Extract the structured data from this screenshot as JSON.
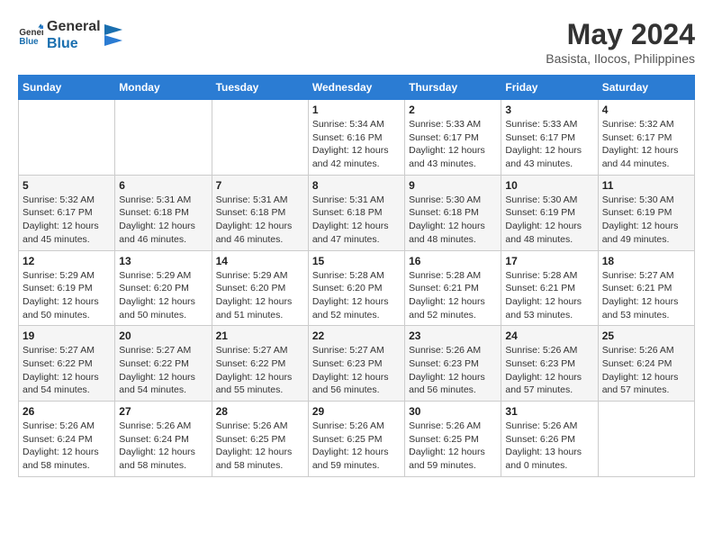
{
  "header": {
    "logo_line1": "General",
    "logo_line2": "Blue",
    "month_year": "May 2024",
    "location": "Basista, Ilocos, Philippines"
  },
  "weekdays": [
    "Sunday",
    "Monday",
    "Tuesday",
    "Wednesday",
    "Thursday",
    "Friday",
    "Saturday"
  ],
  "weeks": [
    [
      {
        "day": "",
        "info": ""
      },
      {
        "day": "",
        "info": ""
      },
      {
        "day": "",
        "info": ""
      },
      {
        "day": "1",
        "info": "Sunrise: 5:34 AM\nSunset: 6:16 PM\nDaylight: 12 hours\nand 42 minutes."
      },
      {
        "day": "2",
        "info": "Sunrise: 5:33 AM\nSunset: 6:17 PM\nDaylight: 12 hours\nand 43 minutes."
      },
      {
        "day": "3",
        "info": "Sunrise: 5:33 AM\nSunset: 6:17 PM\nDaylight: 12 hours\nand 43 minutes."
      },
      {
        "day": "4",
        "info": "Sunrise: 5:32 AM\nSunset: 6:17 PM\nDaylight: 12 hours\nand 44 minutes."
      }
    ],
    [
      {
        "day": "5",
        "info": "Sunrise: 5:32 AM\nSunset: 6:17 PM\nDaylight: 12 hours\nand 45 minutes."
      },
      {
        "day": "6",
        "info": "Sunrise: 5:31 AM\nSunset: 6:18 PM\nDaylight: 12 hours\nand 46 minutes."
      },
      {
        "day": "7",
        "info": "Sunrise: 5:31 AM\nSunset: 6:18 PM\nDaylight: 12 hours\nand 46 minutes."
      },
      {
        "day": "8",
        "info": "Sunrise: 5:31 AM\nSunset: 6:18 PM\nDaylight: 12 hours\nand 47 minutes."
      },
      {
        "day": "9",
        "info": "Sunrise: 5:30 AM\nSunset: 6:18 PM\nDaylight: 12 hours\nand 48 minutes."
      },
      {
        "day": "10",
        "info": "Sunrise: 5:30 AM\nSunset: 6:19 PM\nDaylight: 12 hours\nand 48 minutes."
      },
      {
        "day": "11",
        "info": "Sunrise: 5:30 AM\nSunset: 6:19 PM\nDaylight: 12 hours\nand 49 minutes."
      }
    ],
    [
      {
        "day": "12",
        "info": "Sunrise: 5:29 AM\nSunset: 6:19 PM\nDaylight: 12 hours\nand 50 minutes."
      },
      {
        "day": "13",
        "info": "Sunrise: 5:29 AM\nSunset: 6:20 PM\nDaylight: 12 hours\nand 50 minutes."
      },
      {
        "day": "14",
        "info": "Sunrise: 5:29 AM\nSunset: 6:20 PM\nDaylight: 12 hours\nand 51 minutes."
      },
      {
        "day": "15",
        "info": "Sunrise: 5:28 AM\nSunset: 6:20 PM\nDaylight: 12 hours\nand 52 minutes."
      },
      {
        "day": "16",
        "info": "Sunrise: 5:28 AM\nSunset: 6:21 PM\nDaylight: 12 hours\nand 52 minutes."
      },
      {
        "day": "17",
        "info": "Sunrise: 5:28 AM\nSunset: 6:21 PM\nDaylight: 12 hours\nand 53 minutes."
      },
      {
        "day": "18",
        "info": "Sunrise: 5:27 AM\nSunset: 6:21 PM\nDaylight: 12 hours\nand 53 minutes."
      }
    ],
    [
      {
        "day": "19",
        "info": "Sunrise: 5:27 AM\nSunset: 6:22 PM\nDaylight: 12 hours\nand 54 minutes."
      },
      {
        "day": "20",
        "info": "Sunrise: 5:27 AM\nSunset: 6:22 PM\nDaylight: 12 hours\nand 54 minutes."
      },
      {
        "day": "21",
        "info": "Sunrise: 5:27 AM\nSunset: 6:22 PM\nDaylight: 12 hours\nand 55 minutes."
      },
      {
        "day": "22",
        "info": "Sunrise: 5:27 AM\nSunset: 6:23 PM\nDaylight: 12 hours\nand 56 minutes."
      },
      {
        "day": "23",
        "info": "Sunrise: 5:26 AM\nSunset: 6:23 PM\nDaylight: 12 hours\nand 56 minutes."
      },
      {
        "day": "24",
        "info": "Sunrise: 5:26 AM\nSunset: 6:23 PM\nDaylight: 12 hours\nand 57 minutes."
      },
      {
        "day": "25",
        "info": "Sunrise: 5:26 AM\nSunset: 6:24 PM\nDaylight: 12 hours\nand 57 minutes."
      }
    ],
    [
      {
        "day": "26",
        "info": "Sunrise: 5:26 AM\nSunset: 6:24 PM\nDaylight: 12 hours\nand 58 minutes."
      },
      {
        "day": "27",
        "info": "Sunrise: 5:26 AM\nSunset: 6:24 PM\nDaylight: 12 hours\nand 58 minutes."
      },
      {
        "day": "28",
        "info": "Sunrise: 5:26 AM\nSunset: 6:25 PM\nDaylight: 12 hours\nand 58 minutes."
      },
      {
        "day": "29",
        "info": "Sunrise: 5:26 AM\nSunset: 6:25 PM\nDaylight: 12 hours\nand 59 minutes."
      },
      {
        "day": "30",
        "info": "Sunrise: 5:26 AM\nSunset: 6:25 PM\nDaylight: 12 hours\nand 59 minutes."
      },
      {
        "day": "31",
        "info": "Sunrise: 5:26 AM\nSunset: 6:26 PM\nDaylight: 13 hours\nand 0 minutes."
      },
      {
        "day": "",
        "info": ""
      }
    ]
  ]
}
